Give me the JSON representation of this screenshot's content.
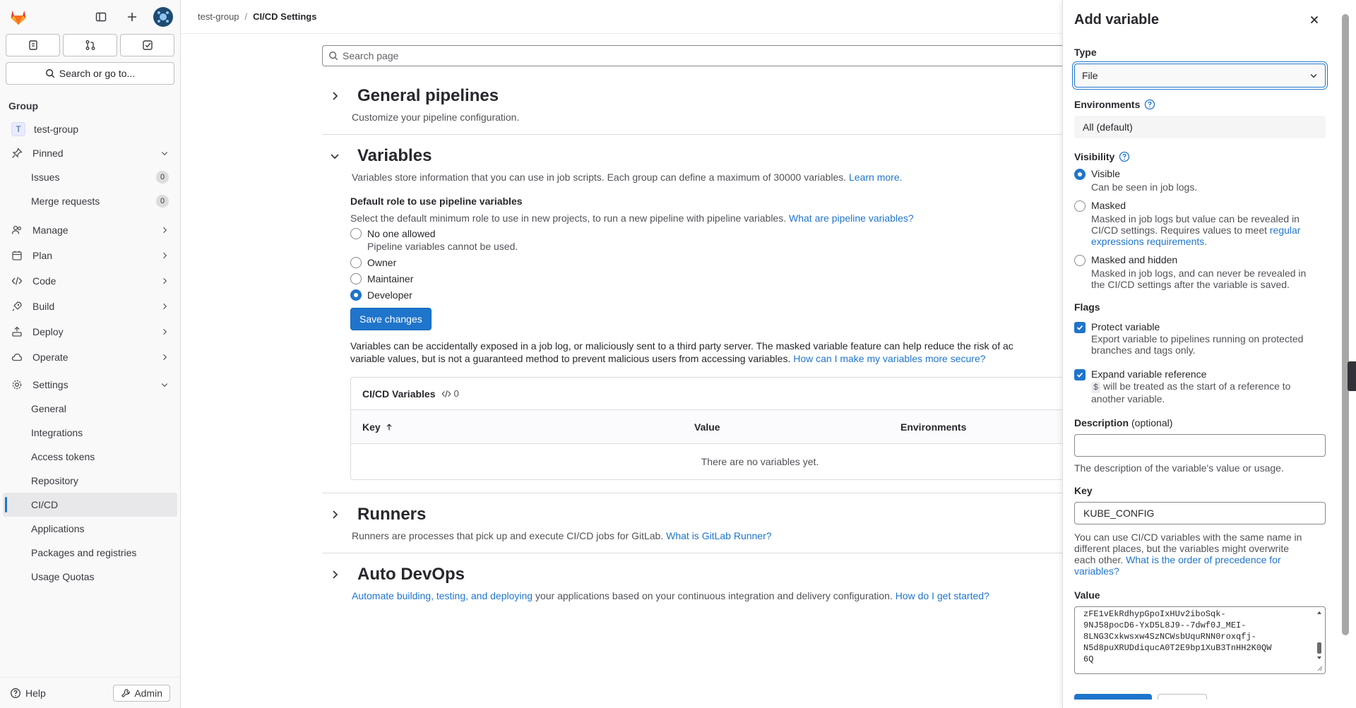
{
  "breadcrumb": {
    "parent": "test-group",
    "current": "CI/CD Settings"
  },
  "sidebar": {
    "search_label": "Search or go to...",
    "section_label": "Group",
    "group": {
      "initial": "T",
      "name": "test-group"
    },
    "pinned": {
      "label": "Pinned",
      "items": [
        {
          "label": "Issues",
          "count": "0"
        },
        {
          "label": "Merge requests",
          "count": "0"
        }
      ]
    },
    "nav": [
      {
        "label": "Manage",
        "icon": "users-icon"
      },
      {
        "label": "Plan",
        "icon": "calendar-icon"
      },
      {
        "label": "Code",
        "icon": "code-icon"
      },
      {
        "label": "Build",
        "icon": "rocket-icon"
      },
      {
        "label": "Deploy",
        "icon": "deploy-icon"
      },
      {
        "label": "Operate",
        "icon": "cloud-icon"
      }
    ],
    "settings": {
      "label": "Settings",
      "items": [
        "General",
        "Integrations",
        "Access tokens",
        "Repository",
        "CI/CD",
        "Applications",
        "Packages and registries",
        "Usage Quotas"
      ],
      "active": "CI/CD"
    },
    "help_label": "Help",
    "admin_label": "Admin"
  },
  "main": {
    "search_placeholder": "Search page",
    "general": {
      "title": "General pipelines",
      "desc": "Customize your pipeline configuration."
    },
    "variables": {
      "title": "Variables",
      "desc": "Variables store information that you can use in job scripts. Each group can define a maximum of 30000 variables.",
      "desc_link": "Learn more.",
      "role_heading": "Default role to use pipeline variables",
      "role_desc": "Select the default minimum role to use in new projects, to run a new pipeline with pipeline variables.",
      "role_link": "What are pipeline variables?",
      "roles": [
        {
          "label": "No one allowed",
          "help": "Pipeline variables cannot be used."
        },
        {
          "label": "Owner"
        },
        {
          "label": "Maintainer"
        },
        {
          "label": "Developer"
        }
      ],
      "save_label": "Save changes",
      "warning_1": "Variables can be accidentally exposed in a job log, or maliciously sent to a third party server. The masked variable feature can help reduce the risk of ac",
      "warning_2": "variable values, but is not a guaranteed method to prevent malicious users from accessing variables.",
      "warning_link": "How can I make my variables more secure?",
      "card_title": "CI/CD Variables",
      "card_count": "0",
      "columns": [
        "Key",
        "Value",
        "Environments"
      ],
      "empty": "There are no variables yet."
    },
    "runners": {
      "title": "Runners",
      "desc": "Runners are processes that pick up and execute CI/CD jobs for GitLab.",
      "link": "What is GitLab Runner?"
    },
    "autodevops": {
      "title": "Auto DevOps",
      "link1": "Automate building, testing, and deploying",
      "desc": " your applications based on your continuous integration and delivery configuration.",
      "link2": "How do I get started?"
    }
  },
  "drawer": {
    "title": "Add variable",
    "type_label": "Type",
    "type_value": "File",
    "env_label": "Environments",
    "env_value": "All (default)",
    "visibility_label": "Visibility",
    "visibility": [
      {
        "label": "Visible",
        "help": "Can be seen in job logs."
      },
      {
        "label": "Masked",
        "help1": "Masked in job logs but value can be revealed in",
        "help2": "CI/CD settings. Requires values to meet ",
        "help_link1": "regular",
        "help_link2": "expressions requirements."
      },
      {
        "label": "Masked and hidden",
        "help1": "Masked in job logs, and can never be revealed in",
        "help2": "the CI/CD settings after the variable is saved."
      }
    ],
    "flags_label": "Flags",
    "protect": {
      "label": "Protect variable",
      "help1": "Export variable to pipelines running on protected",
      "help2": "branches and tags only."
    },
    "expand": {
      "label": "Expand variable reference",
      "code": "$",
      "help1": " will be treated as the start of a reference to",
      "help2": "another variable."
    },
    "desc_label": "Description",
    "desc_optional": "(optional)",
    "desc_hint": "The description of the variable's value or usage.",
    "key_label": "Key",
    "key_value": "KUBE_CONFIG",
    "key_hint1": "You can use CI/CD variables with the same name in",
    "key_hint2": "different places, but the variables might overwrite",
    "key_hint3": "each other. ",
    "key_hint_link1": "What is the order of precedence for",
    "key_hint_link2": "variables?",
    "value_label": "Value",
    "value_lines": [
      "zFE1vEkRdhypGpoIxHUv2iboSqk-",
      "9NJ58pocD6-YxD5L8J9--7dwf0J_MEI-",
      "8LNG3Cxkwsxw4SzNCWsbUquRNN0roxqfj-",
      "N5d8puXRUDdiqucA0T2E9bp1XuB3TnHH2K0QW",
      "6Q"
    ]
  },
  "colors": {
    "accent": "#1f75cb",
    "brand": "#e24329"
  }
}
